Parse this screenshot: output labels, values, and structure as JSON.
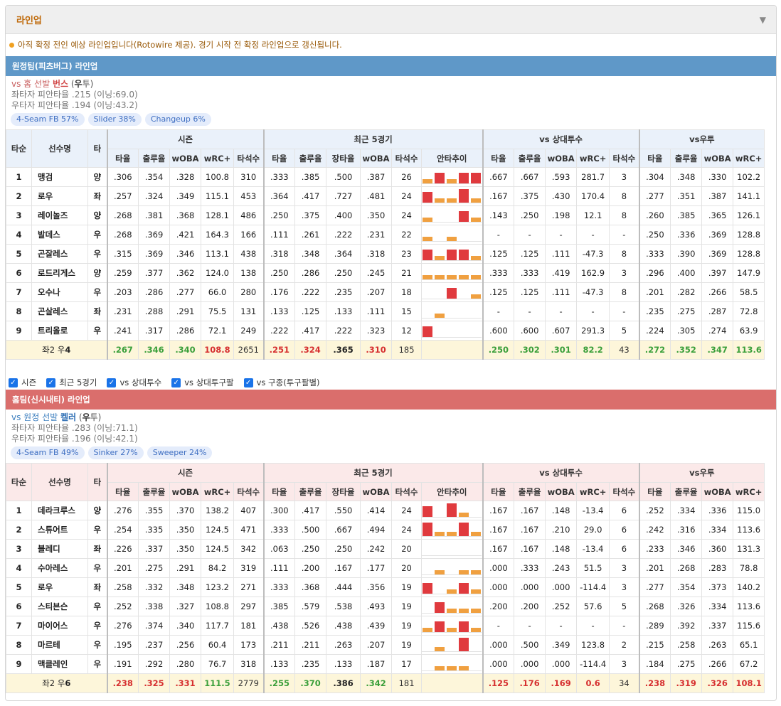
{
  "title": "라인업",
  "notice": "아직 확정 전인 예상 라인업입니다(Rotowire 제공). 경기 시작 전 확정 라인업으로 갱신됩니다.",
  "headers": {
    "order": "타순",
    "name": "선수명",
    "bat": "타",
    "groups": [
      "시즌",
      "최근 5경기",
      "vs 상대투수",
      "vs우투"
    ],
    "season_cols": [
      "타율",
      "출루율",
      "wOBA",
      "wRC+",
      "타석수"
    ],
    "recent_cols": [
      "타율",
      "출루율",
      "장타율",
      "wOBA",
      "타석수",
      "안타추이"
    ],
    "vsp_cols": [
      "타율",
      "출루율",
      "wOBA",
      "wRC+",
      "타석수"
    ],
    "vsh_cols": [
      "타율",
      "출루율",
      "wOBA",
      "wRC+"
    ]
  },
  "checks": [
    "시즌",
    "최근 5경기",
    "vs 상대투수",
    "vs 상대투구팔",
    "vs 구종(투구팔별)"
  ],
  "colors": {
    "away": "#5f98c8",
    "home": "#da6e6c",
    "bar_red": "#e03a3e",
    "bar_orange": "#f0a040"
  },
  "away": {
    "title": "원정팀(피츠버그) 라인업",
    "pitcher": {
      "vs_text": "vs 홈 선발",
      "name": "번스",
      "hand_prefix": "(",
      "hand": "우",
      "hand_suffix": "투)"
    },
    "lhb": "좌타자 피안타율 .215 (이닝:69.0)",
    "rhb": "우타자 피안타율 .194 (이닝:43.2)",
    "tags": [
      "4-Seam FB 57%",
      "Slider 38%",
      "Changeup 6%"
    ],
    "rows": [
      {
        "n": "1",
        "name": "맹검",
        "b": "양",
        "s": [
          ".306",
          ".354",
          ".328",
          "100.8",
          "310"
        ],
        "r": [
          ".333",
          ".385",
          ".500",
          ".387",
          "26"
        ],
        "spark": [
          1,
          3,
          1,
          3,
          3
        ],
        "p": [
          ".667",
          ".667",
          ".593",
          "281.7",
          "3"
        ],
        "h": [
          ".304",
          ".348",
          ".330",
          "102.2"
        ]
      },
      {
        "n": "2",
        "name": "로우",
        "b": "좌",
        "s": [
          ".257",
          ".324",
          ".349",
          "115.1",
          "453"
        ],
        "r": [
          ".364",
          ".417",
          ".727",
          ".481",
          "24"
        ],
        "spark": [
          3,
          1,
          1,
          4,
          1
        ],
        "p": [
          ".167",
          ".375",
          ".430",
          "170.4",
          "8"
        ],
        "h": [
          ".277",
          ".351",
          ".387",
          "141.1"
        ]
      },
      {
        "n": "3",
        "name": "레이놀즈",
        "b": "양",
        "s": [
          ".268",
          ".381",
          ".368",
          "128.1",
          "486"
        ],
        "r": [
          ".250",
          ".375",
          ".400",
          ".350",
          "24"
        ],
        "spark": [
          1,
          0,
          0,
          3,
          1
        ],
        "p": [
          ".143",
          ".250",
          ".198",
          "12.1",
          "8"
        ],
        "h": [
          ".260",
          ".385",
          ".365",
          "126.1"
        ]
      },
      {
        "n": "4",
        "name": "발데스",
        "b": "우",
        "s": [
          ".268",
          ".369",
          ".421",
          "164.3",
          "166"
        ],
        "r": [
          ".111",
          ".261",
          ".222",
          ".231",
          "22"
        ],
        "spark": [
          1,
          0,
          1,
          0,
          0
        ],
        "p": [
          "-",
          "-",
          "-",
          "-",
          "-"
        ],
        "h": [
          ".250",
          ".336",
          ".369",
          "128.8"
        ]
      },
      {
        "n": "5",
        "name": "곤잘레스",
        "b": "우",
        "s": [
          ".315",
          ".369",
          ".346",
          "113.1",
          "438"
        ],
        "r": [
          ".318",
          ".348",
          ".364",
          ".318",
          "23"
        ],
        "spark": [
          3,
          1,
          3,
          3,
          1
        ],
        "p": [
          ".125",
          ".125",
          ".111",
          "-47.3",
          "8"
        ],
        "h": [
          ".333",
          ".390",
          ".369",
          "128.8"
        ]
      },
      {
        "n": "6",
        "name": "로드리게스",
        "b": "양",
        "s": [
          ".259",
          ".377",
          ".362",
          "124.0",
          "138"
        ],
        "r": [
          ".250",
          ".286",
          ".250",
          ".245",
          "21"
        ],
        "spark": [
          1,
          1,
          1,
          1,
          1
        ],
        "p": [
          ".333",
          ".333",
          ".419",
          "162.9",
          "3"
        ],
        "h": [
          ".296",
          ".400",
          ".397",
          "147.9"
        ]
      },
      {
        "n": "7",
        "name": "오수나",
        "b": "우",
        "s": [
          ".203",
          ".286",
          ".277",
          "66.0",
          "280"
        ],
        "r": [
          ".176",
          ".222",
          ".235",
          ".207",
          "18"
        ],
        "spark": [
          0,
          0,
          3,
          0,
          1
        ],
        "p": [
          ".125",
          ".125",
          ".111",
          "-47.3",
          "8"
        ],
        "h": [
          ".201",
          ".282",
          ".266",
          "58.5"
        ]
      },
      {
        "n": "8",
        "name": "곤살레스",
        "b": "좌",
        "s": [
          ".231",
          ".288",
          ".291",
          "75.5",
          "131"
        ],
        "r": [
          ".133",
          ".125",
          ".133",
          ".111",
          "15"
        ],
        "spark": [
          0,
          1,
          0,
          0,
          0
        ],
        "p": [
          "-",
          "-",
          "-",
          "-",
          "-"
        ],
        "h": [
          ".235",
          ".275",
          ".287",
          "72.8"
        ]
      },
      {
        "n": "9",
        "name": "트리올로",
        "b": "우",
        "s": [
          ".241",
          ".317",
          ".286",
          "72.1",
          "249"
        ],
        "r": [
          ".222",
          ".417",
          ".222",
          ".323",
          "12"
        ],
        "spark": [
          3,
          0,
          0,
          0,
          0
        ],
        "p": [
          ".600",
          ".600",
          ".607",
          "291.3",
          "5"
        ],
        "h": [
          ".224",
          ".305",
          ".274",
          "63.9"
        ]
      }
    ],
    "total": {
      "label_pre": "좌2 우",
      "label_num": "4",
      "s": [
        ".267",
        ".346",
        ".340",
        "108.8",
        "2651"
      ],
      "r": [
        ".251",
        ".324",
        ".365",
        ".310",
        "185"
      ],
      "p": [
        ".250",
        ".302",
        ".301",
        "82.2",
        "43"
      ],
      "h": [
        ".272",
        ".352",
        ".347",
        "113.6"
      ],
      "s_cls": [
        "gr",
        "gr",
        "gr",
        "r",
        "nb"
      ],
      "r_cls": [
        "r",
        "r",
        "bk",
        "r",
        "nb"
      ],
      "p_cls": [
        "gr",
        "gr",
        "gr",
        "gr",
        "nb"
      ],
      "h_cls": [
        "gr",
        "gr",
        "gr",
        "gr"
      ]
    }
  },
  "home": {
    "title": "홈팀(신시내티) 라인업",
    "pitcher": {
      "vs_text": "vs 원정 선발",
      "name": "켈러",
      "hand_prefix": "(",
      "hand": "우",
      "hand_suffix": "투)"
    },
    "lhb": "좌타자 피안타율 .283 (이닝:71.1)",
    "rhb": "우타자 피안타율 .196 (이닝:42.1)",
    "tags": [
      "4-Seam FB 49%",
      "Sinker 27%",
      "Sweeper 24%"
    ],
    "rows": [
      {
        "n": "1",
        "name": "데라크루스",
        "b": "양",
        "s": [
          ".276",
          ".355",
          ".370",
          "138.2",
          "407"
        ],
        "r": [
          ".300",
          ".417",
          ".550",
          ".414",
          "24"
        ],
        "spark": [
          3,
          0,
          4,
          1,
          0
        ],
        "p": [
          ".167",
          ".167",
          ".148",
          "-13.4",
          "6"
        ],
        "h": [
          ".252",
          ".334",
          ".336",
          "115.0"
        ]
      },
      {
        "n": "2",
        "name": "스튜어트",
        "b": "우",
        "s": [
          ".254",
          ".335",
          ".350",
          "124.5",
          "471"
        ],
        "r": [
          ".333",
          ".500",
          ".667",
          ".494",
          "24"
        ],
        "spark": [
          4,
          1,
          1,
          4,
          1
        ],
        "p": [
          ".167",
          ".167",
          ".210",
          "29.0",
          "6"
        ],
        "h": [
          ".242",
          ".316",
          ".334",
          "113.6"
        ]
      },
      {
        "n": "3",
        "name": "블레디",
        "b": "좌",
        "s": [
          ".226",
          ".337",
          ".350",
          "124.5",
          "342"
        ],
        "r": [
          ".063",
          ".250",
          ".250",
          ".242",
          "20"
        ],
        "spark": [
          0,
          0,
          0,
          0,
          0
        ],
        "p": [
          ".167",
          ".167",
          ".148",
          "-13.4",
          "6"
        ],
        "h": [
          ".233",
          ".346",
          ".360",
          "131.3"
        ]
      },
      {
        "n": "4",
        "name": "수아레스",
        "b": "우",
        "s": [
          ".201",
          ".275",
          ".291",
          "84.2",
          "319"
        ],
        "r": [
          ".111",
          ".200",
          ".167",
          ".177",
          "20"
        ],
        "spark": [
          0,
          1,
          0,
          1,
          1
        ],
        "p": [
          ".000",
          ".333",
          ".243",
          "51.5",
          "3"
        ],
        "h": [
          ".201",
          ".268",
          ".283",
          "78.8"
        ]
      },
      {
        "n": "5",
        "name": "로우",
        "b": "좌",
        "s": [
          ".258",
          ".332",
          ".348",
          "123.2",
          "271"
        ],
        "r": [
          ".333",
          ".368",
          ".444",
          ".356",
          "19"
        ],
        "spark": [
          3,
          0,
          1,
          3,
          1
        ],
        "p": [
          ".000",
          ".000",
          ".000",
          "-114.4",
          "3"
        ],
        "h": [
          ".277",
          ".354",
          ".373",
          "140.2"
        ]
      },
      {
        "n": "6",
        "name": "스티븐슨",
        "b": "우",
        "s": [
          ".252",
          ".338",
          ".327",
          "108.8",
          "297"
        ],
        "r": [
          ".385",
          ".579",
          ".538",
          ".493",
          "19"
        ],
        "spark": [
          0,
          3,
          1,
          1,
          1
        ],
        "p": [
          ".200",
          ".200",
          ".252",
          "57.6",
          "5"
        ],
        "h": [
          ".268",
          ".326",
          ".334",
          "113.6"
        ]
      },
      {
        "n": "7",
        "name": "마이어스",
        "b": "우",
        "s": [
          ".276",
          ".374",
          ".340",
          "117.7",
          "181"
        ],
        "r": [
          ".438",
          ".526",
          ".438",
          ".439",
          "19"
        ],
        "spark": [
          1,
          3,
          1,
          3,
          1
        ],
        "p": [
          "-",
          "-",
          "-",
          "-",
          "-"
        ],
        "h": [
          ".289",
          ".392",
          ".337",
          "115.6"
        ]
      },
      {
        "n": "8",
        "name": "마르테",
        "b": "우",
        "s": [
          ".195",
          ".237",
          ".256",
          "60.4",
          "173"
        ],
        "r": [
          ".211",
          ".211",
          ".263",
          ".207",
          "19"
        ],
        "spark": [
          0,
          1,
          0,
          4,
          0
        ],
        "p": [
          ".000",
          ".500",
          ".349",
          "123.8",
          "2"
        ],
        "h": [
          ".215",
          ".258",
          ".263",
          "65.1"
        ]
      },
      {
        "n": "9",
        "name": "맥클레인",
        "b": "우",
        "s": [
          ".191",
          ".292",
          ".280",
          "76.7",
          "318"
        ],
        "r": [
          ".133",
          ".235",
          ".133",
          ".187",
          "17"
        ],
        "spark": [
          0,
          1,
          1,
          1,
          0
        ],
        "p": [
          ".000",
          ".000",
          ".000",
          "-114.4",
          "3"
        ],
        "h": [
          ".184",
          ".275",
          ".266",
          "67.2"
        ]
      }
    ],
    "total": {
      "label_pre": "좌2 우",
      "label_num": "6",
      "s": [
        ".238",
        ".325",
        ".331",
        "111.5",
        "2779"
      ],
      "r": [
        ".255",
        ".370",
        ".386",
        ".342",
        "181"
      ],
      "p": [
        ".125",
        ".176",
        ".169",
        "0.6",
        "34"
      ],
      "h": [
        ".238",
        ".319",
        ".326",
        "108.1"
      ],
      "s_cls": [
        "r",
        "r",
        "r",
        "gr",
        "nb"
      ],
      "r_cls": [
        "gr",
        "gr",
        "bk",
        "gr",
        "nb"
      ],
      "p_cls": [
        "r",
        "r",
        "r",
        "r",
        "nb"
      ],
      "h_cls": [
        "r",
        "r",
        "r",
        "r"
      ]
    }
  }
}
